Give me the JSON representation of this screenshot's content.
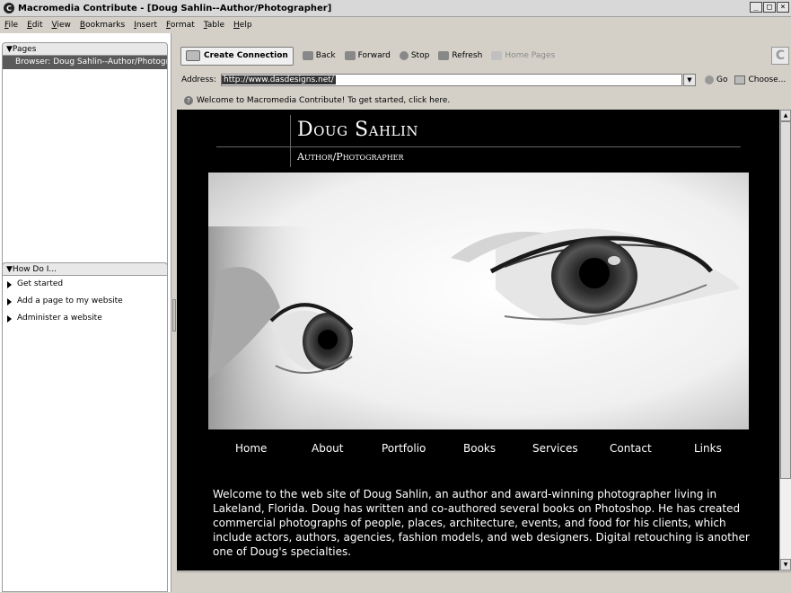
{
  "window": {
    "title": "Macromedia Contribute - [Doug Sahlin--Author/Photographer]"
  },
  "menu": [
    "File",
    "Edit",
    "View",
    "Bookmarks",
    "Insert",
    "Format",
    "Table",
    "Help"
  ],
  "sidebar": {
    "pages_header": "Pages",
    "browser_item": "Browser: Doug Sahlin--Author/Photographer",
    "howdoi_header": "How Do I...",
    "howdoi_items": [
      "Get started",
      "Add a page to my website",
      "Administer a website"
    ]
  },
  "toolbar": {
    "create_connection": "Create Connection",
    "back": "Back",
    "forward": "Forward",
    "stop": "Stop",
    "refresh": "Refresh",
    "home_pages": "Home Pages"
  },
  "address": {
    "label": "Address:",
    "value": "http://www.dasdesigns.net/",
    "go": "Go",
    "choose": "Choose..."
  },
  "welcome_message": "Welcome to Macromedia Contribute! To get started, click here.",
  "site": {
    "name": "Doug Sahlin",
    "subtitle": "Author/Photographer",
    "nav": [
      "Home",
      "About",
      "Portfolio",
      "Books",
      "Services",
      "Contact",
      "Links"
    ],
    "intro": "Welcome to the web site of Doug Sahlin, an author and award-winning photographer living in Lakeland, Florida. Doug has written and co-authored several books on Photoshop. He has created commercial photographs of people, places, architecture, events, and food for his clients, which include actors, authors, agencies, fashion models, and web designers. Digital retouching is another one of Doug's specialties."
  },
  "colors": {
    "chrome": "#d4d0c8",
    "site_bg": "#000000",
    "selected_item": "#5a5a5a"
  }
}
